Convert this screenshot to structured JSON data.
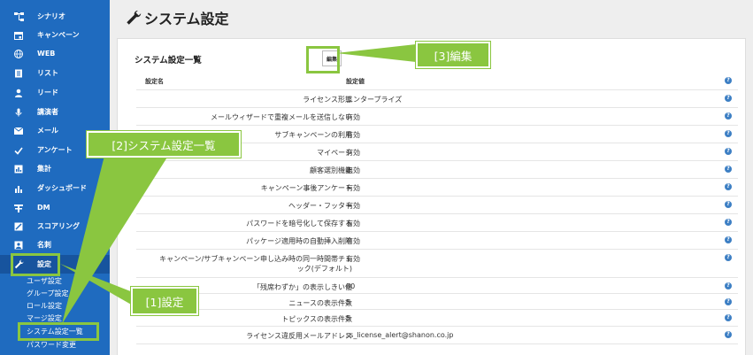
{
  "sidebar": {
    "items": [
      {
        "label": "シナリオ",
        "icon": "sitemap-icon"
      },
      {
        "label": "キャンペーン",
        "icon": "calendar-icon"
      },
      {
        "label": "WEB",
        "icon": "globe-icon"
      },
      {
        "label": "リスト",
        "icon": "list-icon"
      },
      {
        "label": "リード",
        "icon": "user-icon"
      },
      {
        "label": "講演者",
        "icon": "microphone-icon"
      },
      {
        "label": "メール",
        "icon": "envelope-icon"
      },
      {
        "label": "アンケート",
        "icon": "check-icon"
      },
      {
        "label": "集計",
        "icon": "chart-icon"
      },
      {
        "label": "ダッシュボード",
        "icon": "bar-chart-icon"
      },
      {
        "label": "DM",
        "icon": "dm-icon"
      },
      {
        "label": "スコアリング",
        "icon": "scoring-icon"
      },
      {
        "label": "名刺",
        "icon": "card-icon"
      },
      {
        "label": "設定",
        "icon": "wrench-icon"
      }
    ],
    "sub_items": [
      "ユーザ設定",
      "グループ設定",
      "ロール設定",
      "マージ設定",
      "システム設定一覧",
      "パスワード変更"
    ]
  },
  "header": {
    "title": "システム設定"
  },
  "panel": {
    "title": "システム設定一覧",
    "edit_label": "編集",
    "col_name": "設定名",
    "col_value": "設定値",
    "rows": [
      {
        "name": "ライセンス形態",
        "value": "エンタープライズ"
      },
      {
        "name": "メールウィザードで重複メールを送信しない",
        "value": "有効"
      },
      {
        "name": "サブキャンペーンの利用",
        "value": "有効"
      },
      {
        "name": "マイページ",
        "value": "有効"
      },
      {
        "name": "顧客選別機能",
        "value": "無効"
      },
      {
        "name": "キャンペーン事後アンケート",
        "value": "有効"
      },
      {
        "name": "ヘッダー・フッター",
        "value": "有効"
      },
      {
        "name": "パスワードを暗号化して保存する",
        "value": "有効"
      },
      {
        "name": "パッケージ適用時の自動挿入削除",
        "value": "有効"
      },
      {
        "name": "キャンペーン/サブキャンペーン申し込み時の同一時間帯チェック(デフォルト)",
        "value": "有効"
      },
      {
        "name": "「残席わずか」の表示しきい値",
        "value": "80"
      },
      {
        "name": "ニュースの表示件数",
        "value": "5"
      },
      {
        "name": "トピックスの表示件数",
        "value": "5"
      },
      {
        "name": "ライセンス違反用メールアドレス",
        "value": "ss_license_alert@shanon.co.jp"
      }
    ]
  },
  "callouts": {
    "c1": "[1]設定",
    "c2": "[2]システム設定一覧",
    "c3": "[3]編集"
  },
  "colors": {
    "sidebar": "#1f6bbf",
    "callout": "#8ac640",
    "help": "#3d7fc4"
  }
}
